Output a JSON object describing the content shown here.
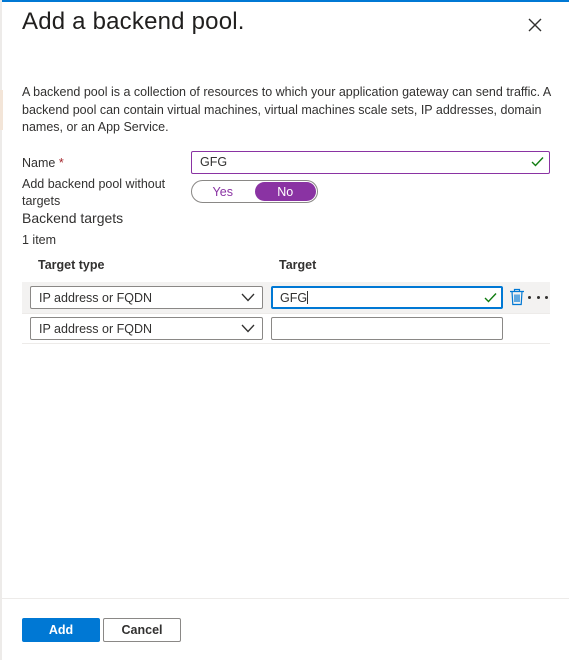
{
  "panel": {
    "title": "Add a backend pool.",
    "description": "A backend pool is a collection of resources to which your application gateway can send traffic. A backend pool can contain virtual machines, virtual machines scale sets, IP addresses, domain names, or an App Service."
  },
  "form": {
    "name_label": "Name",
    "required_mark": "*",
    "name_value": "GFG",
    "without_targets_label": "Add backend pool without targets",
    "toggle_yes": "Yes",
    "toggle_no": "No",
    "toggle_selected": "No"
  },
  "targets": {
    "section_title": "Backend targets",
    "count": "1 item",
    "col_type": "Target type",
    "col_target": "Target",
    "rows": [
      {
        "type": "IP address or FQDN",
        "target": "GFG"
      },
      {
        "type": "IP address or FQDN",
        "target": ""
      }
    ]
  },
  "footer": {
    "add_label": "Add",
    "cancel_label": "Cancel"
  },
  "colors": {
    "accent": "#0078d4",
    "toggle": "#8a33a3",
    "valid_check": "#107c10"
  }
}
